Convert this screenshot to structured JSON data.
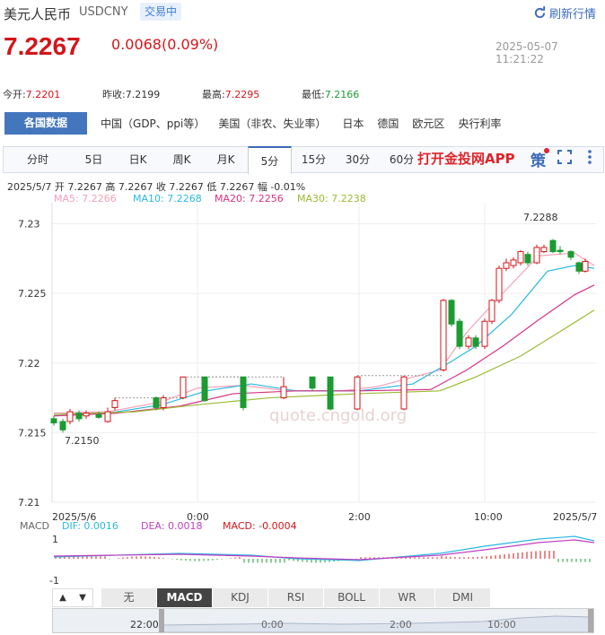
{
  "header": {
    "name": "美元人民币",
    "code": "USDCNY",
    "status": "交易中",
    "refresh": "刷新行情",
    "price": "7.2267",
    "change": "0.0068(0.09%)",
    "time": "2025-05-07 11:21:22"
  },
  "stats": {
    "open_l": "今开:",
    "open": "7.2201",
    "prev_l": "昨收:",
    "prev": "7.2199",
    "high_l": "最高:",
    "high": "7.2295",
    "low_l": "最低:",
    "low": "7.2166"
  },
  "market_bar": {
    "active": "各国数据",
    "items": [
      "中国（GDP、ppi等）",
      "美国（非农、失业率）",
      "日本",
      "德国",
      "欧元区",
      "央行利率"
    ]
  },
  "period_tabs": [
    "分时",
    "5日",
    "日K",
    "周K",
    "月K",
    "5分",
    "15分",
    "30分",
    "60分"
  ],
  "selected_tab": "5分",
  "app_link": "打开金投网APP",
  "ce_label": "策",
  "ohlc_line": "2025/5/7  开 7.2267  高 7.2267  收 7.2267  低 7.2267  幅 -0.01%",
  "ma": {
    "ma5": "MA5: 7.2266",
    "ma10": "MA10: 7.2268",
    "ma20": "MA20: 7.2256",
    "ma30": "MA30: 7.2238"
  },
  "colors": {
    "ma5": "#f4a0b8",
    "ma10": "#2bb8e0",
    "ma20": "#d63384",
    "ma30": "#9cbb34",
    "up": "#d2161a",
    "down": "#1b9b32"
  },
  "watermark": "quote.cngold.org",
  "chart_data": {
    "type": "candlestick",
    "yticks": [
      "7.23",
      "7.225",
      "7.22",
      "7.215",
      "7.21"
    ],
    "xticks": [
      "2025/5/6",
      "0:00",
      "2:00",
      "10:00",
      "2025/5/7"
    ],
    "max_label": "7.2288",
    "min_label": "7.2150",
    "ylim": [
      7.21,
      7.231
    ]
  },
  "macd": {
    "label": "MACD",
    "dif": "DIF: 0.0016",
    "dea": "DEA: 0.0018",
    "macd": "MACD: -0.0004",
    "y1": "1",
    "yn1": "-1"
  },
  "indicator_tabs": [
    "无",
    "MACD",
    "KDJ",
    "RSI",
    "BOLL",
    "WR",
    "DMI"
  ],
  "indicator_selected": "MACD",
  "navigator": {
    "labels": [
      "22:00",
      "0:00",
      "2:00",
      "10:00"
    ]
  }
}
